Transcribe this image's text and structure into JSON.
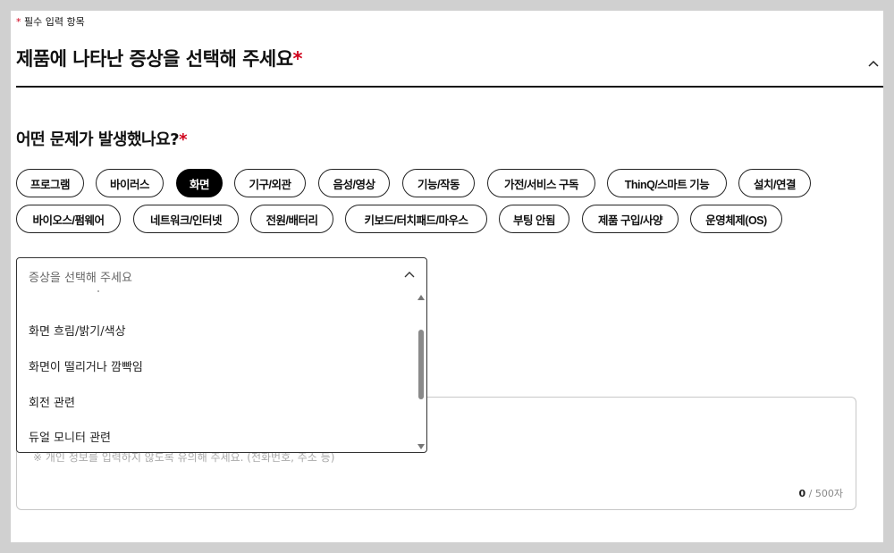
{
  "required_note": {
    "star": "*",
    "text": "필수 입력 항목"
  },
  "section": {
    "title": "제품에 나타난 증상을 선택해 주세요",
    "star": "*"
  },
  "question": {
    "title": "어떤 문제가 발생했나요?",
    "star": "*"
  },
  "categories": [
    {
      "label": "프로그램",
      "selected": false
    },
    {
      "label": "바이러스",
      "selected": false
    },
    {
      "label": "화면",
      "selected": true
    },
    {
      "label": "기구/외관",
      "selected": false
    },
    {
      "label": "음성/영상",
      "selected": false
    },
    {
      "label": "기능/작동",
      "selected": false
    },
    {
      "label": "가전/서비스 구독",
      "selected": false
    },
    {
      "label": "ThinQ/스마트 기능",
      "selected": false
    },
    {
      "label": "설치/연결",
      "selected": false
    },
    {
      "label": "바이오스/펌웨어",
      "selected": false
    },
    {
      "label": "네트워크/인터넷",
      "selected": false
    },
    {
      "label": "전원/배터리",
      "selected": false
    },
    {
      "label": "키보드/터치패드/마우스",
      "selected": false
    },
    {
      "label": "부팅 안됨",
      "selected": false
    },
    {
      "label": "제품 구입/사양",
      "selected": false
    },
    {
      "label": "운영체제(OS)",
      "selected": false
    }
  ],
  "symptom_select": {
    "placeholder": "증상을 선택해 주세요",
    "options": [
      "화면 흐림/밝기/색상",
      "화면이 떨리거나 깜빡임",
      "회전 관련",
      "듀얼 모니터 관련"
    ]
  },
  "description": {
    "placeholder": "※ 개인 정보를 입력하지 않도록 유의해 주세요. (전화번호, 주소 등)",
    "count": "0",
    "max": "/ 500자"
  },
  "colors": {
    "accent_required": "#d0021b",
    "selected_chip": "#000000"
  }
}
